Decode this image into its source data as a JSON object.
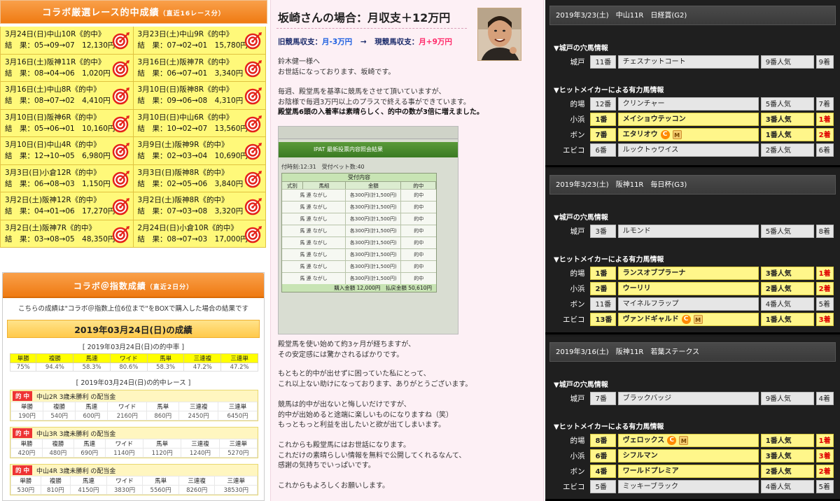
{
  "left": {
    "rec_title": "コラボ厳選レース的中成績",
    "rec_sub": "（直近16レース分）",
    "records": [
      {
        "title": "3月24日(日)中山10R《的中》",
        "result": "結　果：05→09→07　12,130円"
      },
      {
        "title": "3月23日(土)中山9R《的中》",
        "result": "結　果：07→02→01　15,780円"
      },
      {
        "title": "3月16日(土)阪神11R《的中》",
        "result": "結　果：08→04→06　1,020円"
      },
      {
        "title": "3月16日(土)阪神7R《的中》",
        "result": "結　果：06→07→01　3,340円"
      },
      {
        "title": "3月16日(土)中山8R《的中》",
        "result": "結　果：08→07→02　4,410円"
      },
      {
        "title": "3月10日(日)阪神8R《的中》",
        "result": "結　果：09→06→08　4,310円"
      },
      {
        "title": "3月10日(日)阪神6R《的中》",
        "result": "結　果：05→06→01　10,160円"
      },
      {
        "title": "3月10日(日)中山6R《的中》",
        "result": "結　果：10→02→07　13,560円"
      },
      {
        "title": "3月10日(日)中山4R《的中》",
        "result": "結　果：12→10→05　6,980円"
      },
      {
        "title": "3月9日(土)阪神9R《的中》",
        "result": "結　果：02→03→04　10,690円"
      },
      {
        "title": "3月3日(日)小倉12R《的中》",
        "result": "結　果：06→08→03　1,150円"
      },
      {
        "title": "3月3日(日)阪神8R《的中》",
        "result": "結　果：02→05→06　3,840円"
      },
      {
        "title": "3月2日(土)阪神12R《的中》",
        "result": "結　果：04→01→06　17,270円"
      },
      {
        "title": "3月2日(土)阪神8R《的中》",
        "result": "結　果：07→03→08　3,320円"
      },
      {
        "title": "3月2日(土)阪神7R《的中》",
        "result": "結　果：03→08→05　48,350円"
      },
      {
        "title": "2月24日(日)小倉10R《的中》",
        "result": "結　果：08→07→03　17,000円"
      }
    ],
    "idx_title": "コラボ＠指数成績",
    "idx_sub": "（直近2日分）",
    "idx_note": "こちらの成績は\"コラボ＠指数上位6位まで\"をBOXで購入した場合の結果です",
    "idx_date": "2019年03月24日(日)の成績",
    "rate_label": "[ 2019年03月24日(日)の的中率 ]",
    "rate_headers": [
      "単勝",
      "複勝",
      "馬連",
      "ワイド",
      "馬単",
      "三連複",
      "三連単"
    ],
    "rate_values": [
      "75%",
      "94.4%",
      "58.3%",
      "80.6%",
      "58.3%",
      "47.2%",
      "47.2%"
    ],
    "races_label": "[ 2019年03月24日(日)の的中レース ]",
    "badge": "的 中",
    "races": [
      {
        "name": "中山2R 3歳未勝利 の配当金",
        "values": [
          "190円",
          "540円",
          "600円",
          "2160円",
          "860円",
          "2450円",
          "6450円"
        ]
      },
      {
        "name": "中山3R 3歳未勝利 の配当金",
        "values": [
          "420円",
          "480円",
          "690円",
          "1140円",
          "1120円",
          "1240円",
          "5270円"
        ]
      },
      {
        "name": "中山4R 3歳未勝利 の配当金",
        "values": [
          "530円",
          "810円",
          "4150円",
          "3830円",
          "5560円",
          "8260円",
          "38530円"
        ]
      }
    ]
  },
  "mid": {
    "title": "坂崎さんの場合：月収支＋12万円",
    "bal_old_label": "旧競馬収支：",
    "bal_old": "月-3万円",
    "arrow": "→",
    "bal_new_label": "現競馬収支：",
    "bal_new": "月+9万円",
    "p1": [
      "鈴木健一様へ",
      "お世話になっております、坂崎です。"
    ],
    "p2": [
      "毎週、殿堂馬を基準に競馬をさせて頂いていますが、",
      "お陰様で毎週3万円以上のプラスで終える事ができています。"
    ],
    "p2_bold": "殿堂馬6頭の入着率は素晴らしく、的中の数が3倍に増えました。",
    "screen_head": "IPAT 最新投票内容照会結果",
    "screen_time": "付時刻:12:31　受付ベット数:40",
    "screen_table_title": "受付内容",
    "screen_cols": [
      "式別",
      "馬組",
      "金額",
      "的中"
    ],
    "screen_type": "馬 連 ながし",
    "screen_amount": "各300円(計1,500円)",
    "screen_hit": "的中",
    "screen_total": "購入金額 12,000円　払戻金額 50,610円",
    "p3": [
      "殿堂馬を使い始めて約3ヶ月が経ちますが、",
      "その安定感には驚かされるばかりです。"
    ],
    "p4": [
      "もともと的中が出せずに困っていた私にとって、",
      "これ以上ない助けになっております、ありがとうございます。"
    ],
    "p5": [
      "競馬は的中が出ないと悔しいだけですが、",
      "的中が出始めると途端に楽しいものになりますね（笑）",
      "もっともっと利益を出したいと欲が出てしまいます。"
    ],
    "p6": [
      "これからも殿堂馬にはお世話になります。",
      "これだけの素晴らしい情報を無料で公開してくれるなんて、",
      "感謝の気持ちでいっぱいです。"
    ],
    "p7": "これからもよろしくお願いします。"
  },
  "right": {
    "sec_hole": "▼城戸の穴馬情報",
    "sec_hit": "▼ヒットメイカーによる有力馬情報",
    "panels": [
      {
        "head": "2019年3/23(土)　中山11R　日経賞(G2)",
        "hole": {
          "who": "城戸",
          "num": "11番",
          "name": "チェスナットコート",
          "pop": "9番人気",
          "fin": "9着"
        },
        "hits": [
          {
            "who": "的場",
            "num": "12番",
            "name": "クリンチャー",
            "pop": "5番人気",
            "fin": "7着",
            "hl": false,
            "badges": []
          },
          {
            "who": "小浜",
            "num": "1番",
            "name": "メイショウテッコン",
            "pop": "3番人気",
            "fin": "1着",
            "hl": true,
            "badges": []
          },
          {
            "who": "ボン",
            "num": "7番",
            "name": "エタリオウ",
            "pop": "1番人気",
            "fin": "2着",
            "hl": true,
            "badges": [
              "C",
              "M"
            ]
          },
          {
            "who": "エビコ",
            "num": "6番",
            "name": "ルックトゥワイス",
            "pop": "2番人気",
            "fin": "6着",
            "hl": false,
            "badges": []
          }
        ]
      },
      {
        "head": "2019年3/23(土)　阪神11R　毎日杯(G3)",
        "hole": {
          "who": "城戸",
          "num": "3番",
          "name": "ルモンド",
          "pop": "5番人気",
          "fin": "8着"
        },
        "hits": [
          {
            "who": "的場",
            "num": "1番",
            "name": "ランスオブプラーナ",
            "pop": "3番人気",
            "fin": "1着",
            "hl": true,
            "badges": []
          },
          {
            "who": "小浜",
            "num": "2番",
            "name": "ウーリリ",
            "pop": "2番人気",
            "fin": "2着",
            "hl": true,
            "badges": []
          },
          {
            "who": "ボン",
            "num": "11番",
            "name": "マイネルフラップ",
            "pop": "4番人気",
            "fin": "5着",
            "hl": false,
            "badges": []
          },
          {
            "who": "エビコ",
            "num": "13番",
            "name": "ヴァンドギャルド",
            "pop": "1番人気",
            "fin": "3着",
            "hl": true,
            "badges": [
              "C",
              "M"
            ]
          }
        ]
      },
      {
        "head": "2019年3/16(土)　阪神11R　若葉ステークス",
        "hole": {
          "who": "城戸",
          "num": "7番",
          "name": "ブラックバッジ",
          "pop": "9番人気",
          "fin": "4着"
        },
        "hits": [
          {
            "who": "的場",
            "num": "8番",
            "name": "ヴェロックス",
            "pop": "1番人気",
            "fin": "1着",
            "hl": true,
            "badges": [
              "C",
              "M"
            ]
          },
          {
            "who": "小浜",
            "num": "6番",
            "name": "シフルマン",
            "pop": "3番人気",
            "fin": "3着",
            "hl": true,
            "badges": []
          },
          {
            "who": "ボン",
            "num": "4番",
            "name": "ワールドプレミア",
            "pop": "2番人気",
            "fin": "2着",
            "hl": true,
            "badges": []
          },
          {
            "who": "エビコ",
            "num": "5番",
            "name": "ミッキーブラック",
            "pop": "4番人気",
            "fin": "5着",
            "hl": false,
            "badges": []
          }
        ]
      }
    ]
  },
  "colors": {
    "orange": "#ef7a12",
    "yellow": "#fff97a",
    "red": "#e00000",
    "pink_bg": "#fdf0f5",
    "dark_bg": "#1b1b1b"
  },
  "icons": {
    "record": "target-icon",
    "badge_c": "c-badge-icon",
    "badge_m": "m-badge-icon"
  }
}
